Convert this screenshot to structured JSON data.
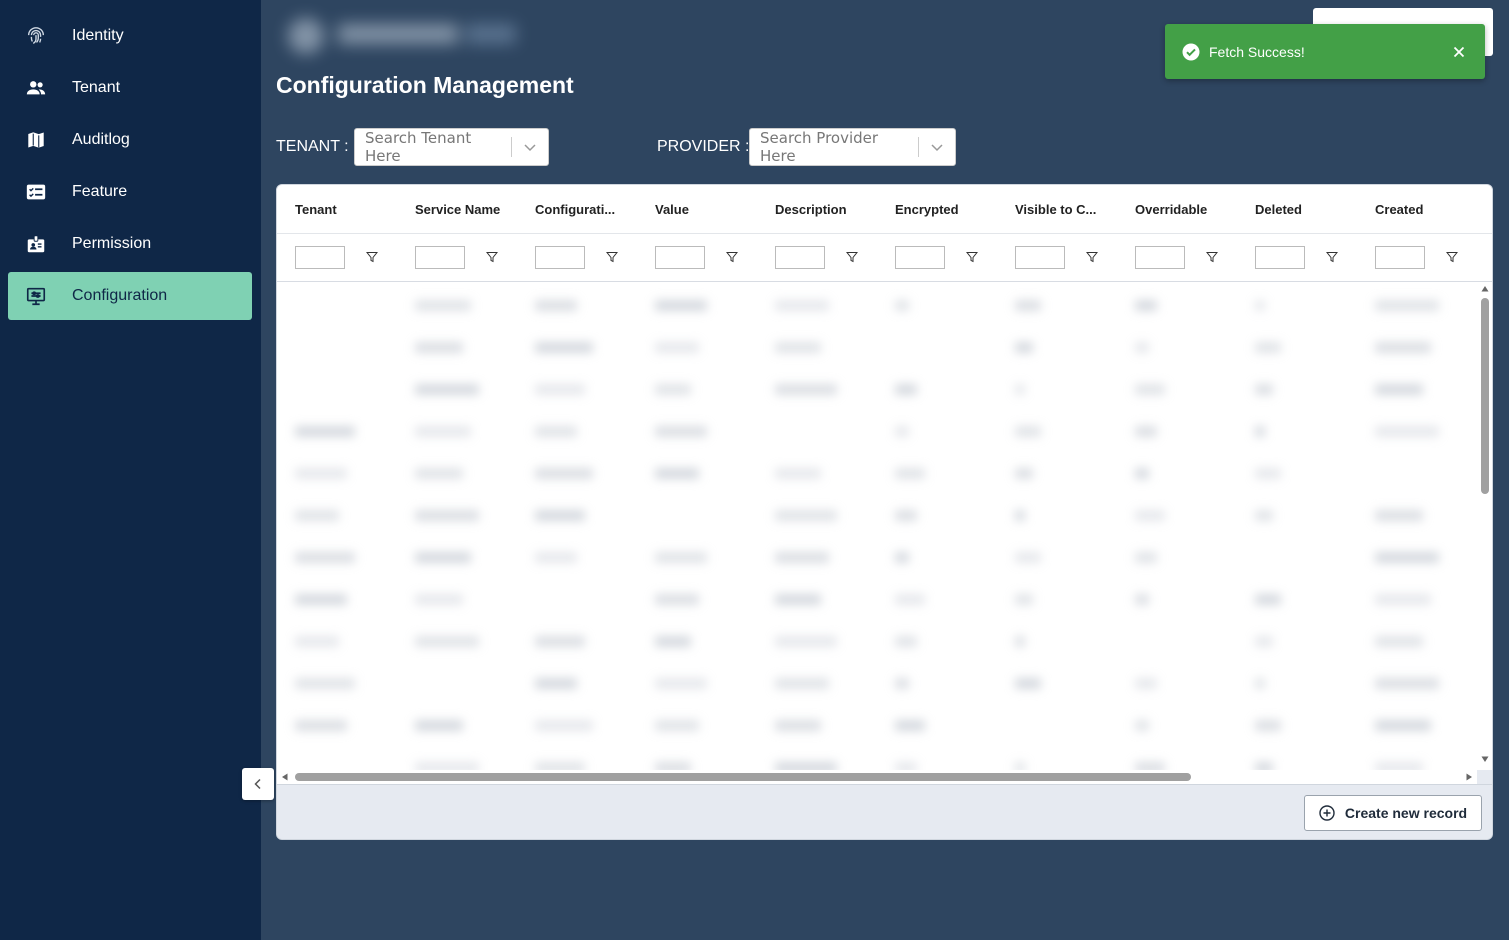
{
  "sidebar": {
    "items": [
      {
        "label": "Identity",
        "icon": "fingerprint-icon"
      },
      {
        "label": "Tenant",
        "icon": "people-icon"
      },
      {
        "label": "Auditlog",
        "icon": "map-icon"
      },
      {
        "label": "Feature",
        "icon": "checklist-icon"
      },
      {
        "label": "Permission",
        "icon": "badge-icon"
      },
      {
        "label": "Configuration",
        "icon": "settings-panel-icon",
        "active": true
      }
    ]
  },
  "toast": {
    "message": "Fetch Success!",
    "color": "#43a047"
  },
  "page": {
    "title": "Configuration Management"
  },
  "filters": {
    "tenant_label": "TENANT :",
    "tenant_placeholder": "Search Tenant Here",
    "provider_label": "PROVIDER :",
    "provider_placeholder": "Search Provider Here"
  },
  "grid": {
    "columns": [
      "Tenant",
      "Service Name",
      "Configurati...",
      "Value",
      "Description",
      "Encrypted",
      "Visible to C...",
      "Overridable",
      "Deleted",
      "Created"
    ],
    "create_label": "Create new record"
  },
  "colors": {
    "sidebar_bg": "#0f2747",
    "active_item": "#7fd1b3",
    "content_bg": "#2e4560"
  }
}
